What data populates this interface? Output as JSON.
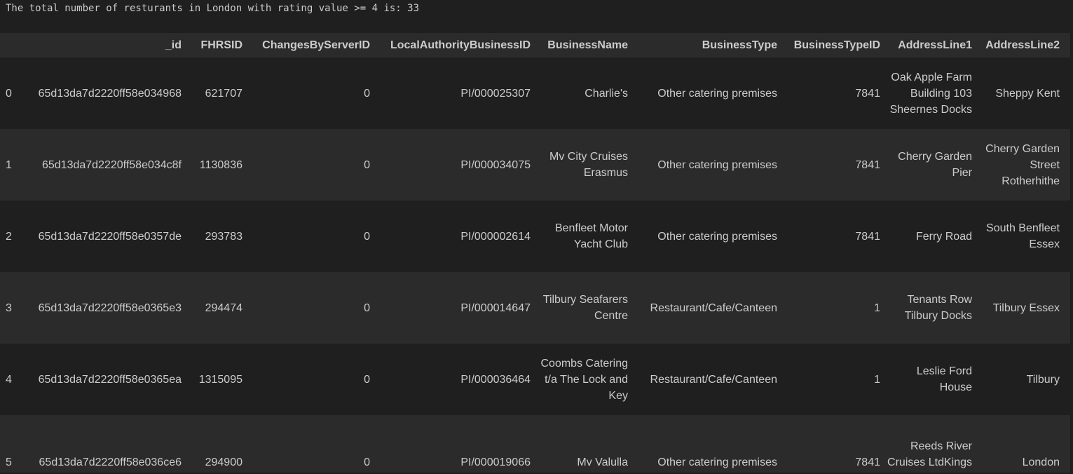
{
  "stdout": "The total number of resturants in London with rating value >= 4 is: 33",
  "table": {
    "columns": [
      "",
      "_id",
      "FHRSID",
      "ChangesByServerID",
      "LocalAuthorityBusinessID",
      "BusinessName",
      "BusinessType",
      "BusinessTypeID",
      "AddressLine1",
      "AddressLine2"
    ],
    "rows": [
      [
        "0",
        "65d13da7d2220ff58e034968",
        "621707",
        "0",
        "PI/000025307",
        "Charlie's",
        "Other catering premises",
        "7841",
        "Oak Apple Farm Building 103 Sheernes Docks",
        "Sheppy Kent"
      ],
      [
        "1",
        "65d13da7d2220ff58e034c8f",
        "1130836",
        "0",
        "PI/000034075",
        "Mv City Cruises Erasmus",
        "Other catering premises",
        "7841",
        "Cherry Garden Pier",
        "Cherry Garden Street Rotherhithe"
      ],
      [
        "2",
        "65d13da7d2220ff58e0357de",
        "293783",
        "0",
        "PI/000002614",
        "Benfleet Motor Yacht Club",
        "Other catering premises",
        "7841",
        "Ferry Road",
        "South Benfleet Essex"
      ],
      [
        "3",
        "65d13da7d2220ff58e0365e3",
        "294474",
        "0",
        "PI/000014647",
        "Tilbury Seafarers Centre",
        "Restaurant/Cafe/Canteen",
        "1",
        "Tenants Row Tilbury Docks",
        "Tilbury Essex"
      ],
      [
        "4",
        "65d13da7d2220ff58e0365ea",
        "1315095",
        "0",
        "PI/000036464",
        "Coombs Catering t/a The Lock and Key",
        "Restaurant/Cafe/Canteen",
        "1",
        "Leslie Ford House",
        "Tilbury"
      ],
      [
        "5",
        "65d13da7d2220ff58e036ce6",
        "294900",
        "0",
        "PI/000019066",
        "Mv Valulla",
        "Other catering premises",
        "7841",
        "Reeds River Cruises LtdKings",
        "London"
      ]
    ]
  }
}
